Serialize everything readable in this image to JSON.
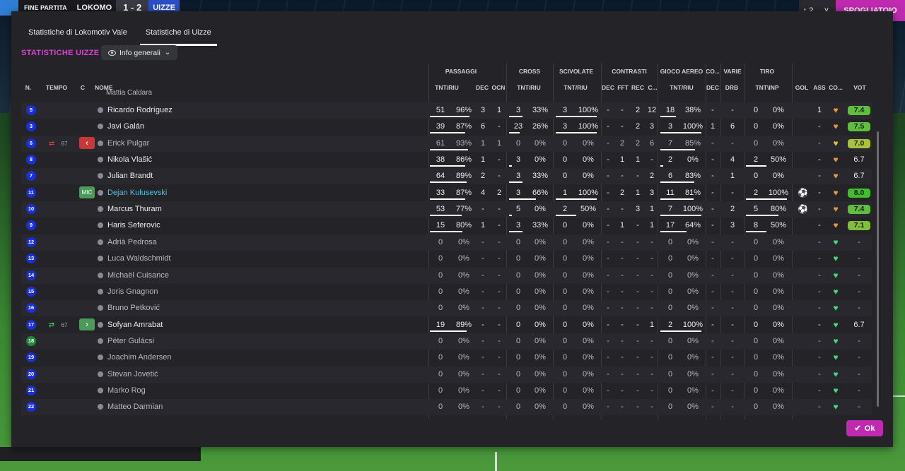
{
  "scoreboard": {
    "status": "FINE PARTITA",
    "home": "LOKOMO",
    "score": "1 - 2",
    "away": "UIZZE"
  },
  "top_right": {
    "mini": "↕ 2",
    "dropdown": "˅",
    "continue": "SPOGLIATOIO"
  },
  "tabs": [
    "Statistiche di Lokomotiv Vale",
    "Statistiche di Uizze"
  ],
  "section_title": "STATISTICHE UIZZE",
  "view_dropdown": {
    "label": "Info generali",
    "icon": "eye-icon"
  },
  "group_headers": [
    "PASSAGGI",
    "CROSS",
    "SCIVOLATE",
    "CONTRASTI",
    "GIOCO AEREO",
    "CO...",
    "VARIE",
    "TIRO"
  ],
  "column_headers": {
    "n": "N.",
    "tempo": "TEMPO",
    "c": "C",
    "nome": "NOME",
    "pass_tr": "TNT/RIU",
    "pass_dec": "DEC",
    "pass_ocn": "OCN",
    "cross_tr": "TNT/RIU",
    "sciv_tr": "TNT/RIU",
    "con_dec": "DEC",
    "con_fft": "FFT",
    "con_rec": "REC",
    "con_c": "C...",
    "aereo_tr": "TNT/RIU",
    "co_dec": "DEC",
    "varie_drb": "DRB",
    "tiro_ti": "TNT\\INP",
    "gol": "GOL",
    "ass": "ASS",
    "cond": "CO...",
    "vot": "VOT"
  },
  "partial_row_name": "Mattia Caldara",
  "rows": [
    {
      "n": "5",
      "gk": false,
      "name": "Ricardo Rodríguez",
      "active": true,
      "pt": "51",
      "pp": "96%",
      "pd": "3",
      "po": "1",
      "ct": "3",
      "cp": "33%",
      "st": "3",
      "sp": "100%",
      "cd": "-",
      "cf": "-",
      "cr": "2",
      "cc": "12",
      "at": "18",
      "ap": "38%",
      "od": "-",
      "dr": "-",
      "tt": "0",
      "tp": "0%",
      "gol": "",
      "ass": "1",
      "heart": "orange",
      "vot": "7.4",
      "votc": "#5fbf3c"
    },
    {
      "n": "3",
      "gk": false,
      "name": "Javi Galán",
      "active": true,
      "pt": "39",
      "pp": "87%",
      "pd": "6",
      "po": "-",
      "ct": "23",
      "cp": "26%",
      "st": "3",
      "sp": "100%",
      "cd": "-",
      "cf": "-",
      "cr": "2",
      "cc": "3",
      "at": "3",
      "ap": "100%",
      "od": "1",
      "dr": "6",
      "tt": "0",
      "tp": "0%",
      "gol": "",
      "ass": "-",
      "heart": "orange",
      "vot": "7.5",
      "votc": "#5fbf3c"
    },
    {
      "n": "6",
      "gk": false,
      "name": "Erick Pulgar",
      "active": false,
      "time": "67",
      "pt": "61",
      "pp": "93%",
      "pd": "1",
      "po": "1",
      "ct": "0",
      "cp": "0%",
      "st": "0",
      "sp": "0%",
      "cd": "-",
      "cf": "2",
      "cr": "2",
      "cc": "6",
      "at": "7",
      "ap": "85%",
      "od": "-",
      "dr": "-",
      "tt": "0",
      "tp": "0%",
      "gol": "",
      "ass": "-",
      "heart": "yellow",
      "vot": "7.0",
      "votc": "#a8c23a"
    },
    {
      "n": "8",
      "gk": false,
      "name": "Nikola Vlašić",
      "active": true,
      "pt": "38",
      "pp": "86%",
      "pd": "1",
      "po": "-",
      "ct": "3",
      "cp": "0%",
      "st": "0",
      "sp": "0%",
      "cd": "-",
      "cf": "1",
      "cr": "1",
      "cc": "-",
      "at": "2",
      "ap": "0%",
      "od": "-",
      "dr": "4",
      "tt": "2",
      "tp": "50%",
      "gol": "",
      "ass": "-",
      "heart": "orange",
      "vot": "6.7",
      "votc": ""
    },
    {
      "n": "7",
      "gk": false,
      "name": "Julian Brandt",
      "active": true,
      "pt": "64",
      "pp": "89%",
      "pd": "2",
      "po": "-",
      "ct": "3",
      "cp": "33%",
      "st": "0",
      "sp": "0%",
      "cd": "-",
      "cf": "-",
      "cr": "-",
      "cc": "2",
      "at": "6",
      "ap": "83%",
      "od": "-",
      "dr": "1",
      "tt": "0",
      "tp": "0%",
      "gol": "",
      "ass": "-",
      "heart": "orange",
      "vot": "6.7",
      "votc": ""
    },
    {
      "n": "11",
      "gk": false,
      "name": "Dejan Kulusevski",
      "active": true,
      "hl": true,
      "badge": "MIC",
      "pt": "33",
      "pp": "87%",
      "pd": "4",
      "po": "2",
      "ct": "3",
      "cp": "66%",
      "st": "1",
      "sp": "100%",
      "cd": "-",
      "cf": "2",
      "cr": "1",
      "cc": "3",
      "at": "11",
      "ap": "81%",
      "od": "-",
      "dr": "-",
      "tt": "2",
      "tp": "100%",
      "gol": "ball",
      "ass": "-",
      "heart": "orange",
      "vot": "8.0",
      "votc": "#3fbf2c"
    },
    {
      "n": "10",
      "gk": false,
      "name": "Marcus Thuram",
      "active": true,
      "pt": "53",
      "pp": "77%",
      "pd": "-",
      "po": "-",
      "ct": "5",
      "cp": "0%",
      "st": "2",
      "sp": "50%",
      "cd": "-",
      "cf": "-",
      "cr": "3",
      "cc": "1",
      "at": "7",
      "ap": "100%",
      "od": "-",
      "dr": "2",
      "tt": "5",
      "tp": "80%",
      "gol": "ball",
      "ass": "-",
      "heart": "orange",
      "vot": "7.4",
      "votc": "#5fbf3c"
    },
    {
      "n": "9",
      "gk": false,
      "name": "Haris Seferovic",
      "active": true,
      "pt": "15",
      "pp": "80%",
      "pd": "1",
      "po": "-",
      "ct": "3",
      "cp": "33%",
      "st": "0",
      "sp": "0%",
      "cd": "-",
      "cf": "1",
      "cr": "-",
      "cc": "1",
      "at": "17",
      "ap": "64%",
      "od": "-",
      "dr": "3",
      "tt": "8",
      "tp": "50%",
      "gol": "",
      "ass": "-",
      "heart": "orange",
      "vot": "7.1",
      "votc": "#7fbf3c"
    },
    {
      "n": "12",
      "gk": false,
      "name": "Adrià Pedrosa",
      "active": false,
      "pt": "0",
      "pp": "0%",
      "pd": "-",
      "po": "-",
      "ct": "0",
      "cp": "0%",
      "st": "0",
      "sp": "0%",
      "cd": "-",
      "cf": "-",
      "cr": "-",
      "cc": "-",
      "at": "0",
      "ap": "0%",
      "od": "-",
      "dr": "-",
      "tt": "0",
      "tp": "0%",
      "gol": "",
      "ass": "-",
      "heart": "green",
      "vot": "-",
      "votc": ""
    },
    {
      "n": "13",
      "gk": false,
      "name": "Luca Waldschmidt",
      "active": false,
      "pt": "0",
      "pp": "0%",
      "pd": "-",
      "po": "-",
      "ct": "0",
      "cp": "0%",
      "st": "0",
      "sp": "0%",
      "cd": "-",
      "cf": "-",
      "cr": "-",
      "cc": "-",
      "at": "0",
      "ap": "0%",
      "od": "-",
      "dr": "-",
      "tt": "0",
      "tp": "0%",
      "gol": "",
      "ass": "-",
      "heart": "green",
      "vot": "-",
      "votc": ""
    },
    {
      "n": "14",
      "gk": false,
      "name": "Michaël Cuisance",
      "active": false,
      "pt": "0",
      "pp": "0%",
      "pd": "-",
      "po": "-",
      "ct": "0",
      "cp": "0%",
      "st": "0",
      "sp": "0%",
      "cd": "-",
      "cf": "-",
      "cr": "-",
      "cc": "-",
      "at": "0",
      "ap": "0%",
      "od": "-",
      "dr": "-",
      "tt": "0",
      "tp": "0%",
      "gol": "",
      "ass": "-",
      "heart": "green",
      "vot": "-",
      "votc": ""
    },
    {
      "n": "15",
      "gk": false,
      "name": "Joris Gnagnon",
      "active": false,
      "pt": "0",
      "pp": "0%",
      "pd": "-",
      "po": "-",
      "ct": "0",
      "cp": "0%",
      "st": "0",
      "sp": "0%",
      "cd": "-",
      "cf": "-",
      "cr": "-",
      "cc": "-",
      "at": "0",
      "ap": "0%",
      "od": "-",
      "dr": "-",
      "tt": "0",
      "tp": "0%",
      "gol": "",
      "ass": "-",
      "heart": "green",
      "vot": "-",
      "votc": ""
    },
    {
      "n": "16",
      "gk": false,
      "name": "Bruno Petković",
      "active": false,
      "pt": "0",
      "pp": "0%",
      "pd": "-",
      "po": "-",
      "ct": "0",
      "cp": "0%",
      "st": "0",
      "sp": "0%",
      "cd": "-",
      "cf": "-",
      "cr": "-",
      "cc": "-",
      "at": "0",
      "ap": "0%",
      "od": "-",
      "dr": "-",
      "tt": "0",
      "tp": "0%",
      "gol": "",
      "ass": "-",
      "heart": "green",
      "vot": "-",
      "votc": ""
    },
    {
      "n": "17",
      "gk": false,
      "name": "Sofyan Amrabat",
      "active": true,
      "time": "67",
      "subin": true,
      "pt": "19",
      "pp": "89%",
      "pd": "-",
      "po": "-",
      "ct": "0",
      "cp": "0%",
      "st": "0",
      "sp": "0%",
      "cd": "-",
      "cf": "-",
      "cr": "-",
      "cc": "1",
      "at": "2",
      "ap": "100%",
      "od": "-",
      "dr": "-",
      "tt": "0",
      "tp": "0%",
      "gol": "",
      "ass": "-",
      "heart": "green",
      "vot": "6.7",
      "votc": ""
    },
    {
      "n": "18",
      "gk": true,
      "name": "Péter Gulácsi",
      "active": false,
      "pt": "0",
      "pp": "0%",
      "pd": "-",
      "po": "-",
      "ct": "0",
      "cp": "0%",
      "st": "0",
      "sp": "0%",
      "cd": "-",
      "cf": "-",
      "cr": "-",
      "cc": "-",
      "at": "0",
      "ap": "0%",
      "od": "-",
      "dr": "-",
      "tt": "0",
      "tp": "0%",
      "gol": "",
      "ass": "-",
      "heart": "green",
      "vot": "-",
      "votc": ""
    },
    {
      "n": "19",
      "gk": false,
      "name": "Joachim Andersen",
      "active": false,
      "pt": "0",
      "pp": "0%",
      "pd": "-",
      "po": "-",
      "ct": "0",
      "cp": "0%",
      "st": "0",
      "sp": "0%",
      "cd": "-",
      "cf": "-",
      "cr": "-",
      "cc": "-",
      "at": "0",
      "ap": "0%",
      "od": "-",
      "dr": "-",
      "tt": "0",
      "tp": "0%",
      "gol": "",
      "ass": "-",
      "heart": "green",
      "vot": "-",
      "votc": ""
    },
    {
      "n": "20",
      "gk": false,
      "name": "Stevan Jovetić",
      "active": false,
      "pt": "0",
      "pp": "0%",
      "pd": "-",
      "po": "-",
      "ct": "0",
      "cp": "0%",
      "st": "0",
      "sp": "0%",
      "cd": "-",
      "cf": "-",
      "cr": "-",
      "cc": "-",
      "at": "0",
      "ap": "0%",
      "od": "-",
      "dr": "-",
      "tt": "0",
      "tp": "0%",
      "gol": "",
      "ass": "-",
      "heart": "green",
      "vot": "-",
      "votc": ""
    },
    {
      "n": "21",
      "gk": false,
      "name": "Marko Rog",
      "active": false,
      "pt": "0",
      "pp": "0%",
      "pd": "-",
      "po": "-",
      "ct": "0",
      "cp": "0%",
      "st": "0",
      "sp": "0%",
      "cd": "-",
      "cf": "-",
      "cr": "-",
      "cc": "-",
      "at": "0",
      "ap": "0%",
      "od": "-",
      "dr": "-",
      "tt": "0",
      "tp": "0%",
      "gol": "",
      "ass": "-",
      "heart": "green",
      "vot": "-",
      "votc": ""
    },
    {
      "n": "22",
      "gk": false,
      "name": "Matteo Darmian",
      "active": false,
      "pt": "0",
      "pp": "0%",
      "pd": "-",
      "po": "-",
      "ct": "0",
      "cp": "0%",
      "st": "0",
      "sp": "0%",
      "cd": "-",
      "cf": "-",
      "cr": "-",
      "cc": "-",
      "at": "0",
      "ap": "0%",
      "od": "-",
      "dr": "-",
      "tt": "0",
      "tp": "0%",
      "gol": "",
      "ass": "-",
      "heart": "green",
      "vot": "-",
      "votc": ""
    }
  ],
  "ok_button": "Ok",
  "colors": {
    "accent": "#c02ab0",
    "title": "#e040d8",
    "highlight_name": "#4fc3e8",
    "player_number": "#1a2fd6",
    "gk_number": "#1f8a3a"
  }
}
